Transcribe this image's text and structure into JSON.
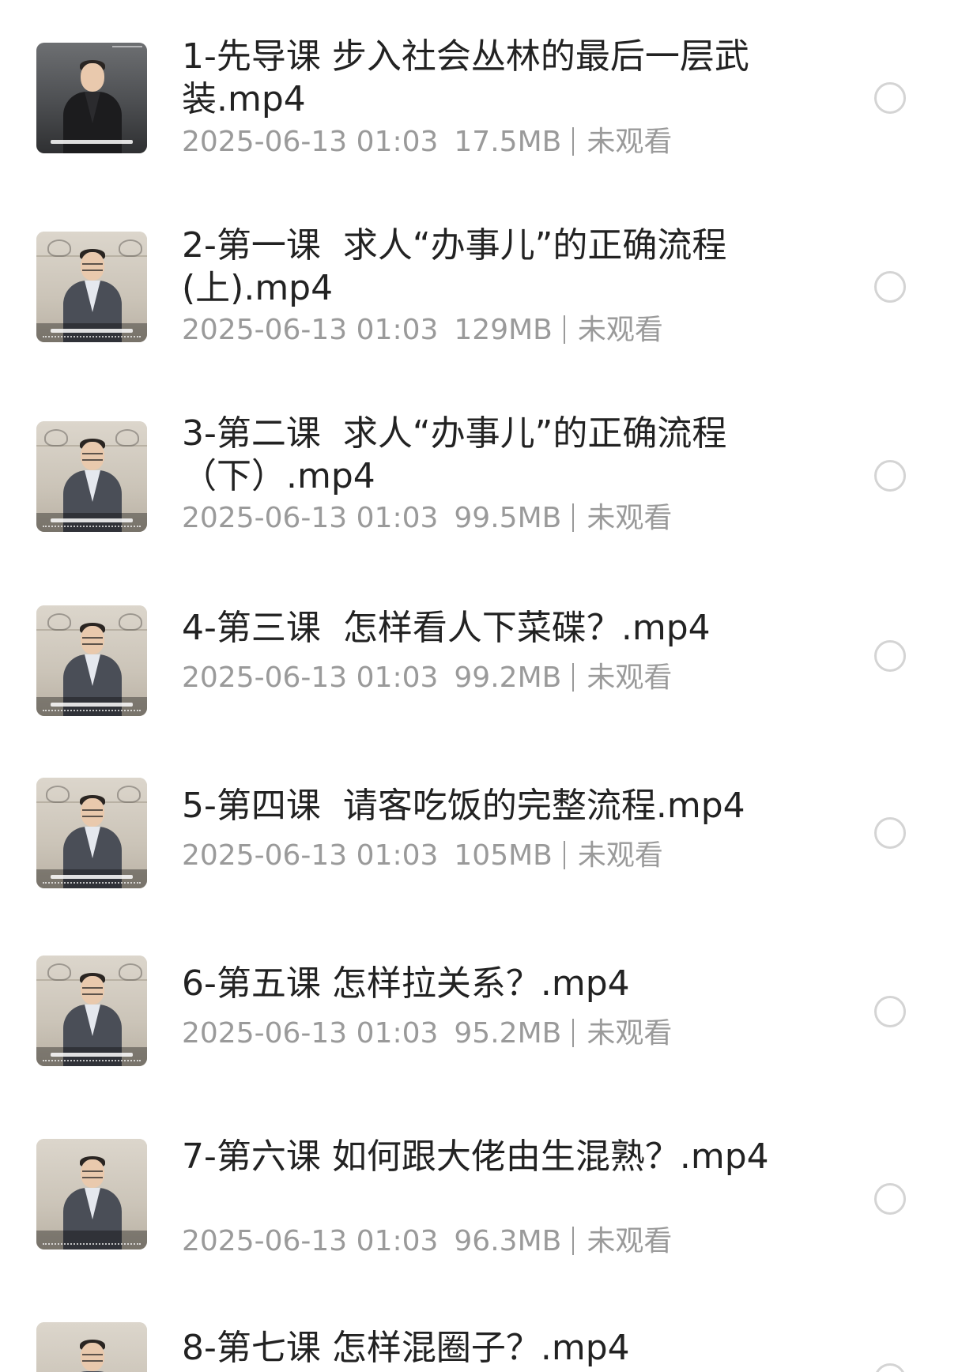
{
  "file_list": {
    "items": [
      {
        "title": "1-先导课 步入社会丛林的最后一层武装.mp4",
        "date": "2025-06-13 01:03",
        "size": "17.5MB",
        "status": "未观看",
        "thumb_caption": "能听懂人家每句话是什么意思",
        "thumb_logo": "KAWS"
      },
      {
        "title": "2-第一课  求人“办事儿”的正确流程(上).mp4",
        "date": "2025-06-13 01:03",
        "size": "129MB",
        "status": "未观看"
      },
      {
        "title": "3-第二课  求人“办事儿”的正确流程（下）.mp4",
        "date": "2025-06-13 01:03",
        "size": "99.5MB",
        "status": "未观看"
      },
      {
        "title": "4-第三课  怎样看人下菜碟？.mp4",
        "date": "2025-06-13 01:03",
        "size": "99.2MB",
        "status": "未观看"
      },
      {
        "title": "5-第四课  请客吃饭的完整流程.mp4",
        "date": "2025-06-13 01:03",
        "size": "105MB",
        "status": "未观看"
      },
      {
        "title": "6-第五课 怎样拉关系？.mp4",
        "date": "2025-06-13 01:03",
        "size": "95.2MB",
        "status": "未观看"
      },
      {
        "title": "7-第六课 如何跟大佬由生混熟？.mp4",
        "date": "2025-06-13 01:03",
        "size": "96.3MB",
        "status": "未观看"
      },
      {
        "title": "8-第七课 怎样混圈子？.mp4"
      }
    ]
  },
  "colors": {
    "title_text": "#222222",
    "meta_text": "#9a9a9a",
    "radio_border": "#d4d4d4",
    "background": "#ffffff"
  }
}
